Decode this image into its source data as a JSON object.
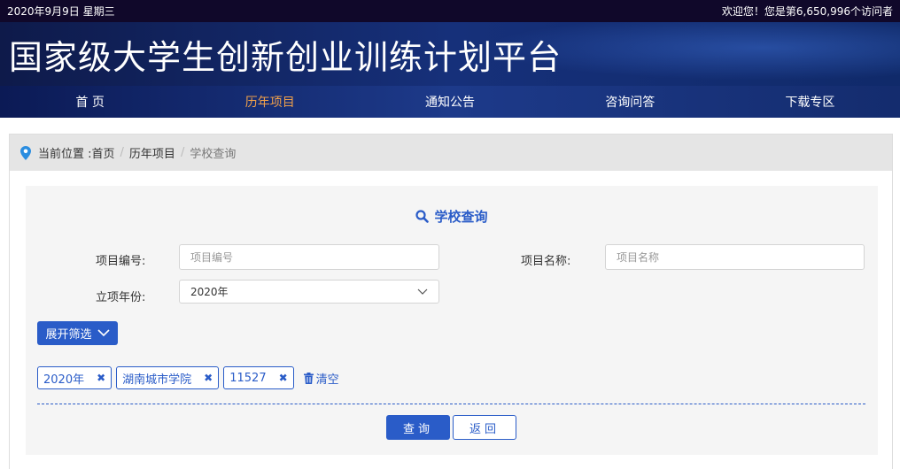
{
  "topbar": {
    "date": "2020年9月9日 星期三",
    "welcome": "欢迎您！您是第6,650,996个访问者"
  },
  "banner": {
    "title": "国家级大学生创新创业训练计划平台"
  },
  "nav": {
    "items": [
      {
        "label": "首 页"
      },
      {
        "label": "历年项目"
      },
      {
        "label": "通知公告"
      },
      {
        "label": "咨询问答"
      },
      {
        "label": "下载专区"
      }
    ],
    "active_color": "#f0a04b"
  },
  "breadcrumb": {
    "prefix": "当前位置 : ",
    "home": "首页",
    "level2": "历年项目",
    "current": "学校查询"
  },
  "form": {
    "title": "学校查询",
    "project_no_label": "项目编号:",
    "project_no_placeholder": "项目编号",
    "project_name_label": "项目名称:",
    "project_name_placeholder": "项目名称",
    "year_label": "立项年份:",
    "year_value": "2020年",
    "expand_label": "展开筛选",
    "tags": [
      "2020年",
      "湖南城市学院",
      "11527"
    ],
    "clear_label": "清空",
    "query_label": "查询",
    "back_label": "返回"
  },
  "colors": {
    "accent": "#2a5cc8",
    "topbar_bg": "#10082a"
  }
}
